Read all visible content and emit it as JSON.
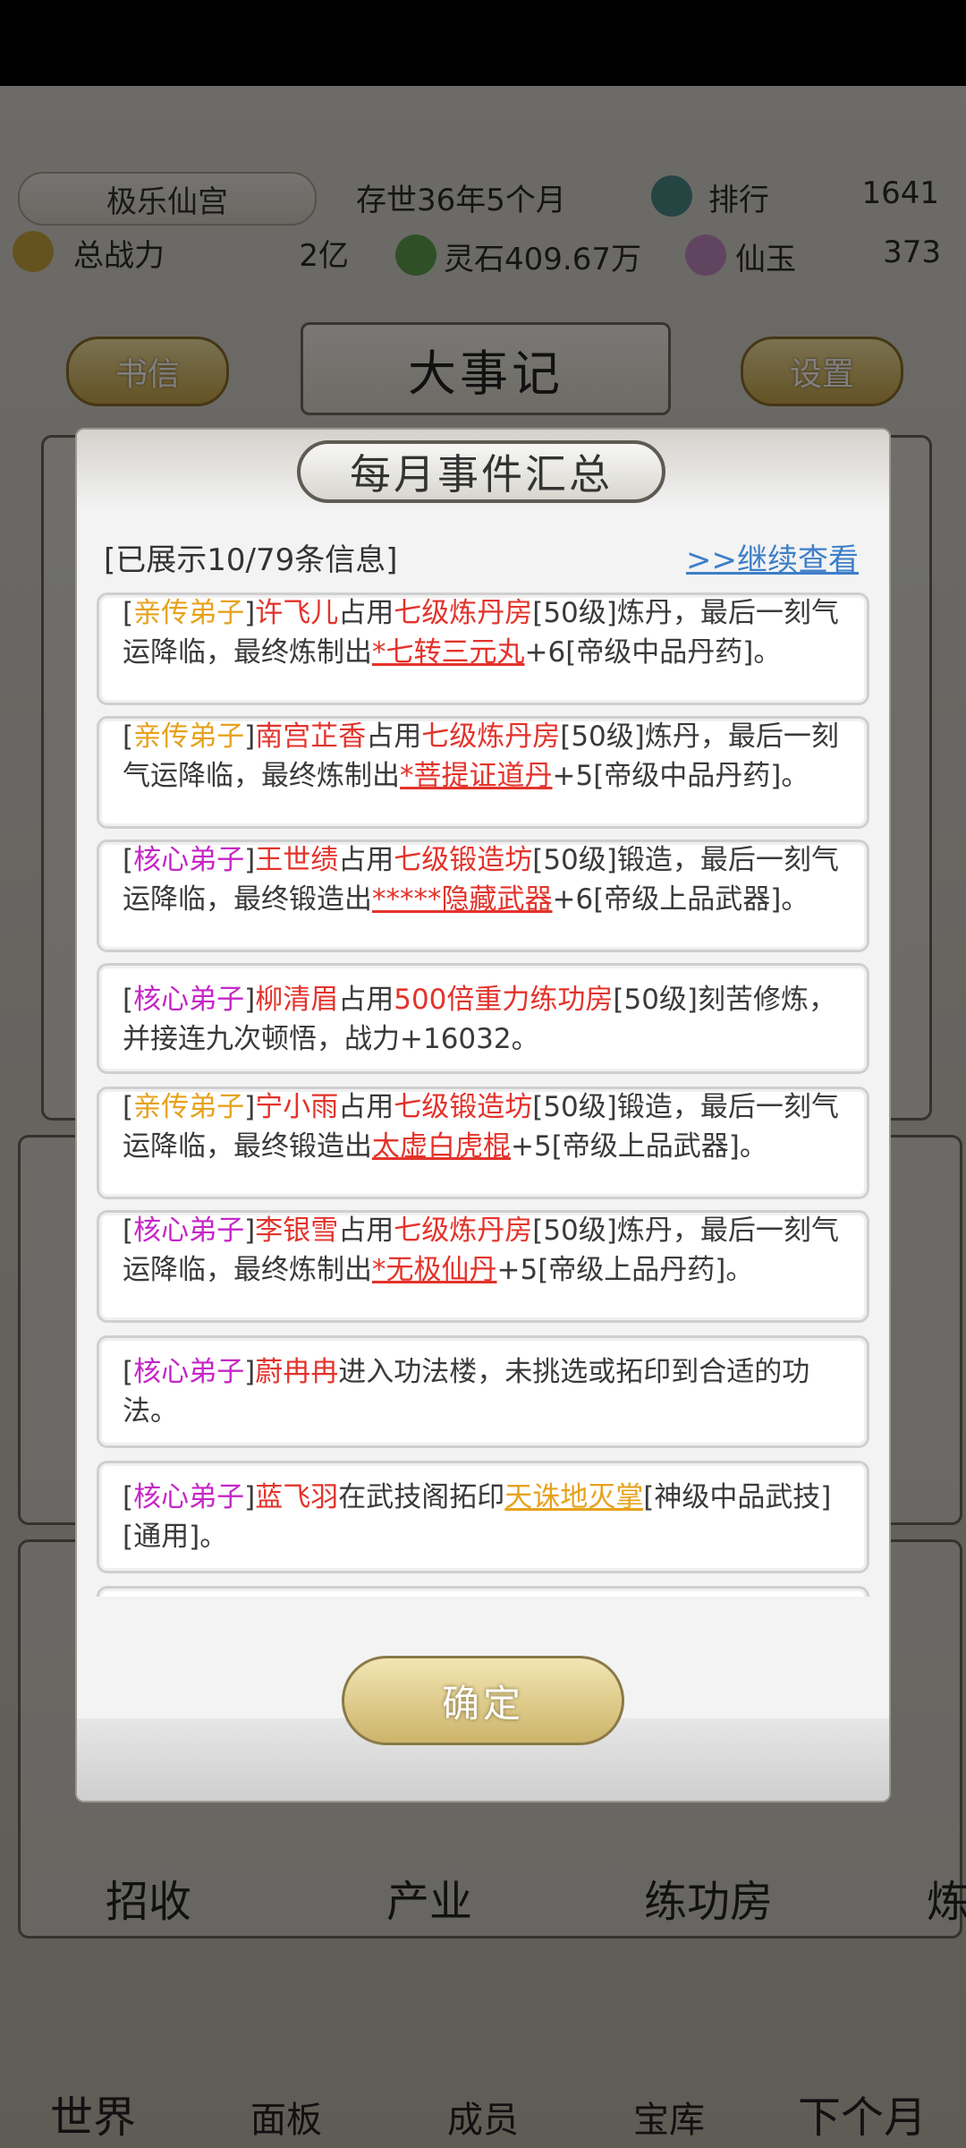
{
  "header": {
    "sect_name": "极乐仙宫",
    "age": "存世36年5个月",
    "rank_label": "排行",
    "rank_value": "1641",
    "power_label": "总战力",
    "power_value": "2亿",
    "spirit_stone": "灵石409.67万",
    "jade_label": "仙玉",
    "jade_value": "373",
    "left_button": "书信",
    "page_title": "大事记",
    "right_button": "设置"
  },
  "bottom": {
    "menu": [
      "招收",
      "产业",
      "练功房",
      "炼"
    ],
    "nav": [
      "世界",
      "面板",
      "成员",
      "宝库",
      "下个月"
    ]
  },
  "modal": {
    "title": "每月事件汇总",
    "shown_info": "[已展示10/79条信息]",
    "more_link": ">>继续查看",
    "confirm": "确定",
    "events": [
      {
        "p1": "[",
        "tag": "亲传弟子",
        "p2": "]",
        "name": "许飞儿",
        "t1": "占用",
        "place": "七级炼丹房",
        "t2": "[50级]炼丹，最后一刻气运降临，最终炼制出",
        "item": "*七转三元丸",
        "t3": "+6[帝级中品丹药]。"
      },
      {
        "p1": "[",
        "tag": "亲传弟子",
        "p2": "]",
        "name": "南宫芷香",
        "t1": "占用",
        "place": "七级炼丹房",
        "t2": "[50级]炼丹，最后一刻气运降临，最终炼制出",
        "item": "*菩提证道丹",
        "t3": "+5[帝级中品丹药]。"
      },
      {
        "p1": "[",
        "tag": "核心弟子",
        "p2": "]",
        "name": "王世绩",
        "t1": "占用",
        "place": "七级锻造坊",
        "t2": "[50级]锻造，最后一刻气运降临，最终锻造出",
        "item": "*****隐藏武器",
        "t3": "+6[帝级上品武器]。"
      },
      {
        "p1": "[",
        "tag": "核心弟子",
        "p2": "]",
        "name": "柳清眉",
        "t1": "占用",
        "place": "500倍重力练功房",
        "t2": "[50级]刻苦修炼，并接连九次顿悟，战力+16032。"
      },
      {
        "p1": "[",
        "tag": "亲传弟子",
        "p2": "]",
        "name": "宁小雨",
        "t1": "占用",
        "place": "七级锻造坊",
        "t2": "[50级]锻造，最后一刻气运降临，最终锻造出",
        "item": "太虚白虎棍",
        "t3": "+5[帝级上品武器]。"
      },
      {
        "p1": "[",
        "tag": "核心弟子",
        "p2": "]",
        "name": "李银雪",
        "t1": "占用",
        "place": "七级炼丹房",
        "t2": "[50级]炼丹，最后一刻气运降临，最终炼制出",
        "item": "*无极仙丹",
        "t3": "+5[帝级上品丹药]。"
      },
      {
        "p1": "[",
        "tag": "核心弟子",
        "p2": "]",
        "name": "蔚冉冉",
        "t1": "进入功法楼，未挑选或拓印到合适的功法。"
      },
      {
        "p1": "[",
        "tag": "核心弟子",
        "p2": "]",
        "name": "蓝飞羽",
        "t1": "在武技阁拓印",
        "item": "天诛地灭掌",
        "t3": "[神级中品武技][通用]。"
      }
    ]
  }
}
